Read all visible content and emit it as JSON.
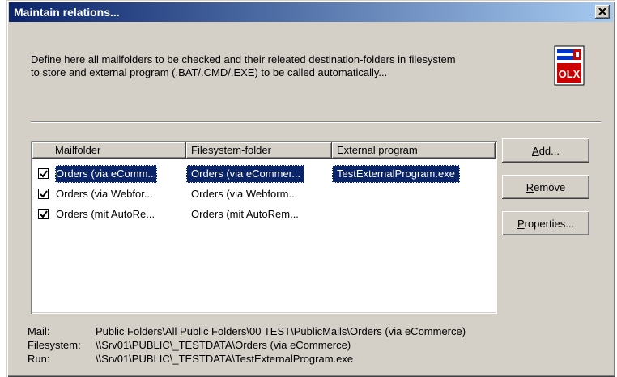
{
  "window": {
    "title": "Maintain relations...",
    "description_line1": "Define here all mailfolders to be checked and their releated destination-folders in filesystem",
    "description_line2": "to store and external program (.BAT/.CMD/.EXE) to be called automatically...",
    "logo_text": "OLX"
  },
  "list": {
    "columns": [
      "Mailfolder",
      "Filesystem-folder",
      "External program"
    ],
    "rows": [
      {
        "checked": true,
        "mailfolder": "Orders (via eComm...",
        "filesystem": "Orders (via eCommer...",
        "program": "TestExternalProgram.exe",
        "selected": true
      },
      {
        "checked": true,
        "mailfolder": "Orders (via Webfor...",
        "filesystem": "Orders (via Webform...",
        "program": "",
        "selected": false
      },
      {
        "checked": true,
        "mailfolder": "Orders (mit AutoRe...",
        "filesystem": "Orders (mit AutoRem...",
        "program": "",
        "selected": false
      }
    ]
  },
  "buttons": {
    "add": {
      "hotkey": "A",
      "rest": "dd..."
    },
    "remove": {
      "hotkey": "R",
      "rest": "emove"
    },
    "properties": {
      "hotkey": "P",
      "rest": "roperties..."
    }
  },
  "details": {
    "mail_label": "Mail:",
    "mail_value": "Public Folders\\All Public Folders\\00 TEST\\PublicMails\\Orders (via eCommerce)",
    "filesystem_label": "Filesystem:",
    "filesystem_value": "\\\\Srv01\\PUBLIC\\_TESTDATA\\Orders (via eCommerce)",
    "run_label": "Run:",
    "run_value": "\\\\Srv01\\PUBLIC\\_TESTDATA\\TestExternalProgram.exe"
  },
  "colors": {
    "titlebar_start": "#0a246a",
    "titlebar_end": "#a6caf0",
    "dialog_face": "#d4d0c8",
    "selection": "#0a246a",
    "logo_red": "#cc0000",
    "logo_blue": "#0033cc"
  }
}
